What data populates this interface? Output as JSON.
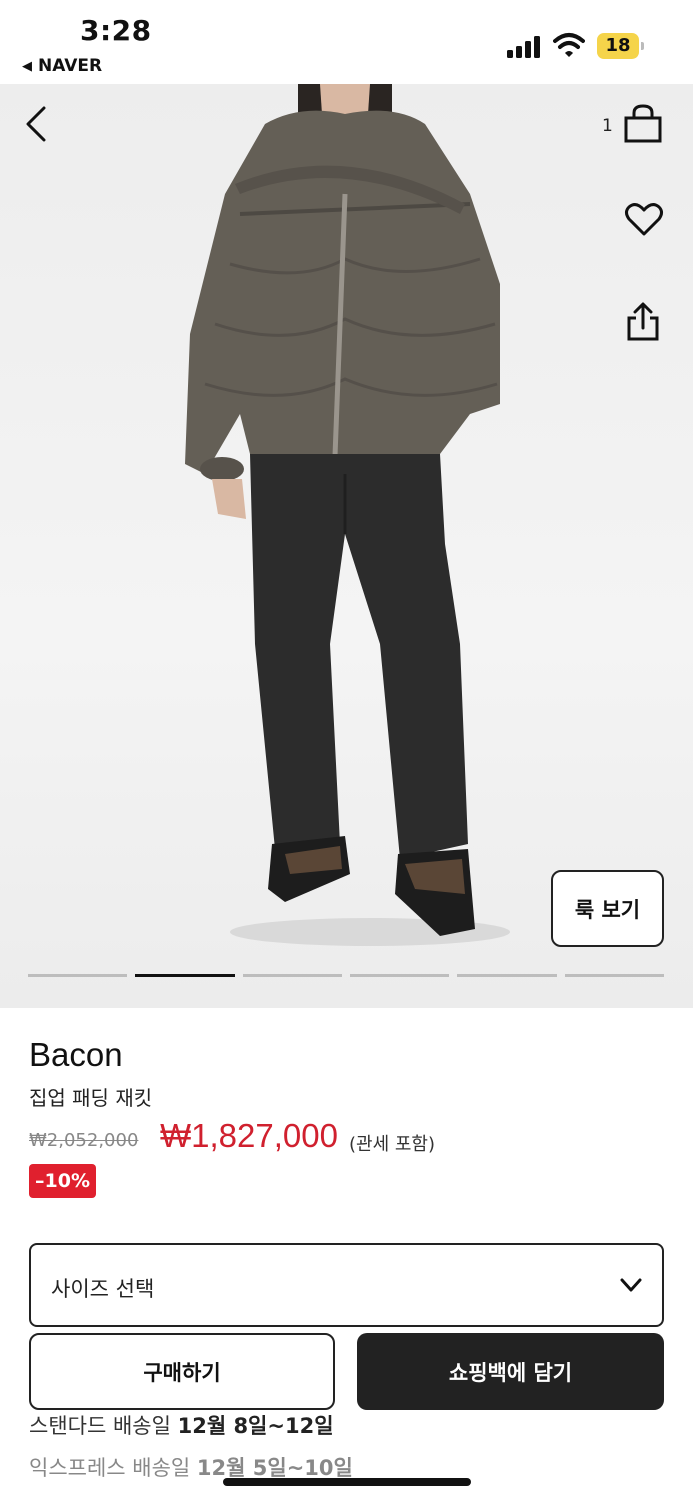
{
  "status_bar": {
    "time": "3:28",
    "back_app": "NAVER",
    "battery_level": "18"
  },
  "header": {
    "bag_count": "1",
    "icons": [
      "back-arrow-icon",
      "shopping-bag-icon",
      "heart-icon",
      "share-icon"
    ]
  },
  "gallery": {
    "look_button_label": "룩 보기",
    "page_count": 6,
    "active_index": 1
  },
  "product": {
    "brand": "Bacon",
    "name": "집업 패딩 재킷",
    "original_price": "₩2,052,000",
    "sale_price": "₩1,827,000",
    "tax_note": "(관세 포함)",
    "discount": "–10%"
  },
  "size_select": {
    "label": "사이즈 선택"
  },
  "actions": {
    "buy_label": "구매하기",
    "cart_label": "쇼핑백에 담기"
  },
  "shipping": {
    "standard_prefix": "스탠다드 배송일 ",
    "standard_dates": "12월 8일~12일",
    "express_prefix": "익스프레스 배송일 ",
    "express_dates": "12월 5일~10일"
  },
  "colors": {
    "sale_red": "#d0202e",
    "badge_red": "#e0202e",
    "dark": "#222222"
  }
}
